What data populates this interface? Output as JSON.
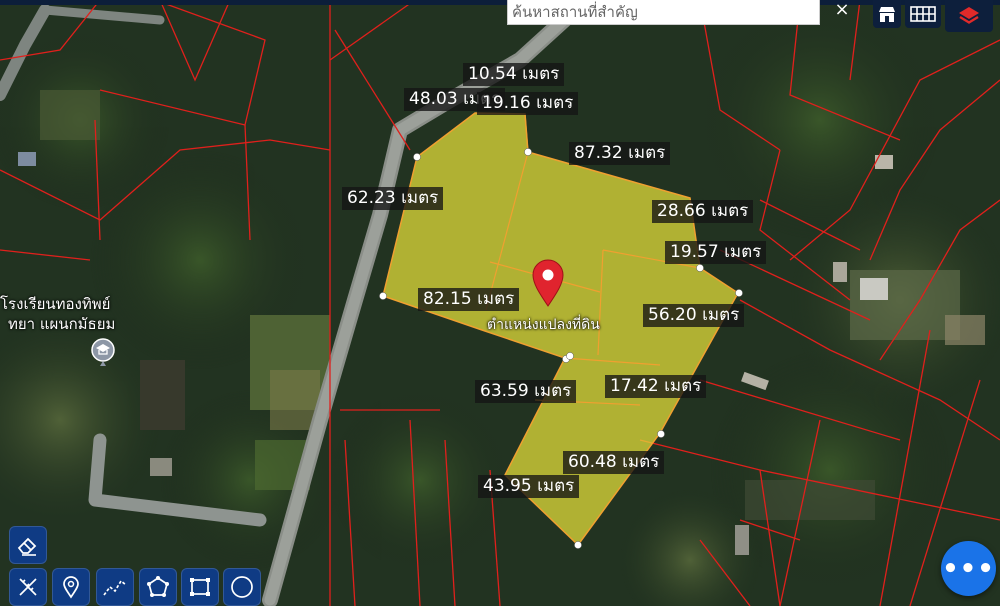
{
  "search": {
    "placeholder": "ค้นหาสถานที่สำคัญ"
  },
  "header": {
    "clear_glyph": "×"
  },
  "toolbar_right": {
    "icons": [
      "poi-layer-icon",
      "grid-icon",
      "layers-icon"
    ]
  },
  "colors": {
    "parcel_fill": "#e8e23a",
    "boundary_red": "#e0201c",
    "header_bg": "#0c1e3a",
    "tool_button_bg": "#0f3b84",
    "fab_bg": "#1a73e8",
    "marker_red": "#e0242e"
  },
  "measurements": [
    "10.54 เมตร",
    "48.03 เมตร",
    "19.16 เมตร",
    "87.32 เมตร",
    "62.23 เมตร",
    "28.66 เมตร",
    "19.57 เมตร",
    "82.15 เมตร",
    "56.20 เมตร",
    "63.59 เมตร",
    "17.42 เมตร",
    "60.48 เมตร",
    "43.95 เมตร"
  ],
  "parcel": {
    "label": "ตำแหน่งแปลงที่ดิน"
  },
  "poi": {
    "line1": "โรงเรียนทองทิพย์",
    "line2": "ทยา แผนกมัธยม",
    "icon": "school-icon"
  },
  "tools": {
    "top": "eraser-icon",
    "bottom": [
      "ruler-pencil-icon",
      "location-pin-icon",
      "polyline-icon",
      "polygon-icon",
      "rectangle-icon",
      "circle-icon"
    ]
  },
  "fab": {
    "glyph": "•••"
  }
}
